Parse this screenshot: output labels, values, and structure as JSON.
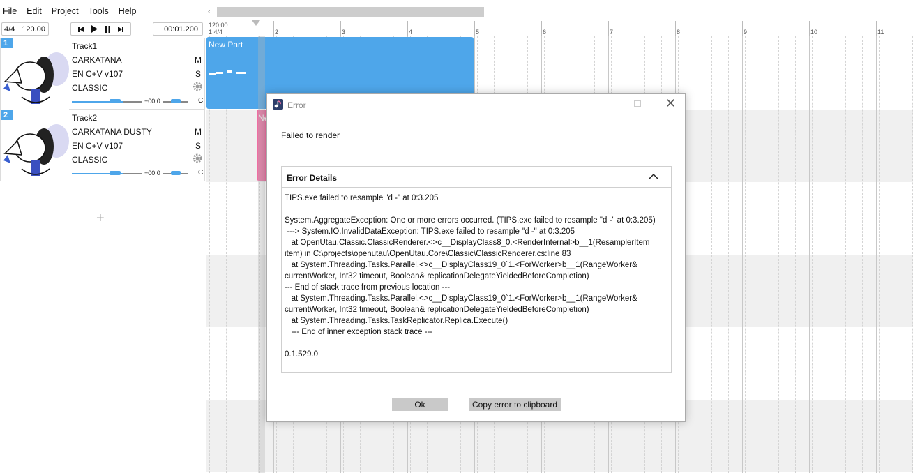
{
  "menu": [
    "File",
    "Edit",
    "Project",
    "Tools",
    "Help"
  ],
  "toolbar": {
    "time_signature": "4/4",
    "tempo": "120.00",
    "position": "00:01.200"
  },
  "ruler": {
    "tempo": "120.00",
    "signature": "1 4/4",
    "bars": [
      "2",
      "3",
      "4",
      "5",
      "6",
      "7",
      "8",
      "9",
      "10",
      "11"
    ]
  },
  "tracks": [
    {
      "number": "1",
      "name": "Track1",
      "singer": "CARKATANA",
      "phonemizer": "EN C+V v107",
      "renderer": "CLASSIC",
      "mute": "M",
      "solo": "S",
      "volume": "+00.0",
      "pan": "C"
    },
    {
      "number": "2",
      "name": "Track2",
      "singer": "CARKATANA DUSTY",
      "phonemizer": "EN C+V v107",
      "renderer": "CLASSIC",
      "mute": "M",
      "solo": "S",
      "volume": "+00.0",
      "pan": "C"
    }
  ],
  "add_track": "+",
  "parts": [
    {
      "label": "New Part"
    },
    {
      "label": "New Part"
    }
  ],
  "dialog": {
    "title": "Error",
    "message": "Failed to render",
    "details_title": "Error Details",
    "details_text": "TIPS.exe failed to resample \"d -\" at 0:3.205\n\nSystem.AggregateException: One or more errors occurred. (TIPS.exe failed to resample \"d -\" at 0:3.205)\n ---> System.IO.InvalidDataException: TIPS.exe failed to resample \"d -\" at 0:3.205\n   at OpenUtau.Classic.ClassicRenderer.<>c__DisplayClass8_0.<RenderInternal>b__1(ResamplerItem\nitem) in C:\\projects\\openutau\\OpenUtau.Core\\Classic\\ClassicRenderer.cs:line 83\n   at System.Threading.Tasks.Parallel.<>c__DisplayClass19_0`1.<ForWorker>b__1(RangeWorker&\ncurrentWorker, Int32 timeout, Boolean& replicationDelegateYieldedBeforeCompletion)\n--- End of stack trace from previous location ---\n   at System.Threading.Tasks.Parallel.<>c__DisplayClass19_0`1.<ForWorker>b__1(RangeWorker&\ncurrentWorker, Int32 timeout, Boolean& replicationDelegateYieldedBeforeCompletion)\n   at System.Threading.Tasks.TaskReplicator.Replica.Execute()\n   --- End of inner exception stack trace ---\n\n0.1.529.0",
    "ok_label": "Ok",
    "copy_label": "Copy error to clipboard"
  },
  "colors": {
    "accent_blue": "#4ea6ea",
    "part_pink": "#f06fa3"
  }
}
